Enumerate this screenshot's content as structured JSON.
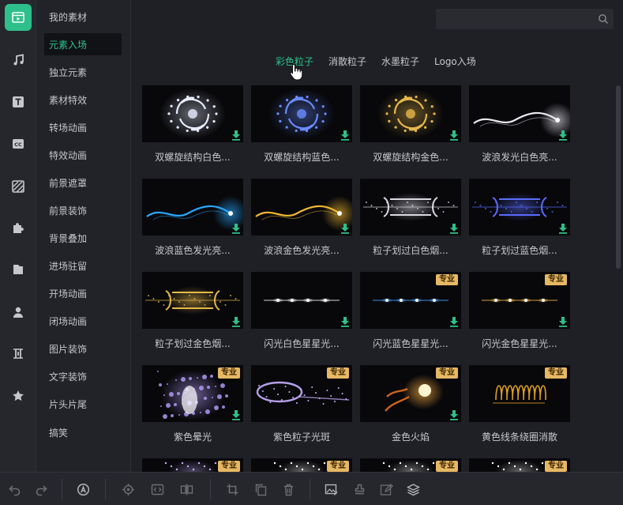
{
  "rail": {
    "items": [
      {
        "icon": "video-clip-icon",
        "active": true
      },
      {
        "icon": "music-note-icon"
      },
      {
        "icon": "text-icon"
      },
      {
        "icon": "subtitle-cc-icon"
      },
      {
        "icon": "filter-stripes-icon"
      },
      {
        "icon": "puzzle-icon"
      },
      {
        "icon": "folder-icon"
      },
      {
        "icon": "person-icon"
      },
      {
        "icon": "pitch-slider-icon"
      },
      {
        "icon": "star-icon"
      }
    ]
  },
  "categories": {
    "items": [
      {
        "label": "我的素材"
      },
      {
        "label": "元素入场",
        "active": true
      },
      {
        "label": "独立元素"
      },
      {
        "label": "素材特效"
      },
      {
        "label": "转场动画"
      },
      {
        "label": "特效动画"
      },
      {
        "label": "前景遮罩"
      },
      {
        "label": "前景装饰"
      },
      {
        "label": "背景叠加"
      },
      {
        "label": "进场驻留"
      },
      {
        "label": "开场动画"
      },
      {
        "label": "闭场动画"
      },
      {
        "label": "图片装饰"
      },
      {
        "label": "文字装饰"
      },
      {
        "label": "片头片尾"
      },
      {
        "label": "搞笑"
      }
    ]
  },
  "search": {
    "placeholder": "",
    "icon": "search-icon"
  },
  "tabs": {
    "items": [
      {
        "label": "彩色粒子",
        "active": true
      },
      {
        "label": "消散粒子"
      },
      {
        "label": "水墨粒子"
      },
      {
        "label": "Logo入场"
      }
    ]
  },
  "grid": {
    "pro_label": "专业",
    "items": [
      {
        "title": "双螺旋结构白色...",
        "art": "swirl",
        "color": "#e8ecff",
        "download": true,
        "pro": false
      },
      {
        "title": "双螺旋结构蓝色...",
        "art": "swirl",
        "color": "#6a8cff",
        "download": true,
        "pro": false
      },
      {
        "title": "双螺旋结构金色...",
        "art": "swirl",
        "color": "#e6b84a",
        "download": true,
        "pro": false
      },
      {
        "title": "波浪发光白色亮...",
        "art": "wave",
        "color": "#e8e8ee",
        "download": true,
        "pro": false
      },
      {
        "title": "波浪蓝色发光亮...",
        "art": "wave",
        "color": "#2aa8ff",
        "download": true,
        "pro": false
      },
      {
        "title": "波浪金色发光亮...",
        "art": "wave",
        "color": "#f0b830",
        "download": true,
        "pro": false
      },
      {
        "title": "粒子划过白色烟...",
        "art": "smoke",
        "color": "#d8d8e0",
        "download": true,
        "pro": false
      },
      {
        "title": "粒子划过蓝色烟...",
        "art": "smoke",
        "color": "#5a6cff",
        "download": true,
        "pro": false
      },
      {
        "title": "粒子划过金色烟...",
        "art": "smoke",
        "color": "#e6b84a",
        "download": true,
        "pro": false
      },
      {
        "title": "闪光白色星星光...",
        "art": "sparkle",
        "color": "#f0f0f6",
        "download": true,
        "pro": false
      },
      {
        "title": "闪光蓝色星星光...",
        "art": "sparkle",
        "color": "#4aa0ff",
        "download": true,
        "pro": true
      },
      {
        "title": "闪光金色星星光...",
        "art": "sparkle",
        "color": "#f0b040",
        "download": true,
        "pro": true
      },
      {
        "title": "紫色晕光",
        "art": "glow",
        "color": "#b8a0ff",
        "download": true,
        "pro": true
      },
      {
        "title": "紫色粒子光斑",
        "art": "comet",
        "color": "#c8b0ff",
        "download": false,
        "pro": true
      },
      {
        "title": "金色火焰",
        "art": "fire",
        "color": "#ffb040",
        "download": true,
        "pro": true
      },
      {
        "title": "黄色线条绕圈消散",
        "art": "coil",
        "color": "#e0a020",
        "download": false,
        "pro": true
      },
      {
        "title": "",
        "art": "partial",
        "color": "#c8b0ff",
        "download": false,
        "pro": true
      },
      {
        "title": "",
        "art": "partial",
        "color": "#ffffff",
        "download": false,
        "pro": true
      },
      {
        "title": "",
        "art": "partial",
        "color": "#ffffff",
        "download": false,
        "pro": true
      },
      {
        "title": "",
        "art": "partial",
        "color": "#ffffff",
        "download": false,
        "pro": true
      }
    ]
  },
  "toolbar": {
    "items": [
      {
        "icon": "undo-icon"
      },
      {
        "icon": "redo-icon"
      },
      {
        "icon": "auto-a-icon"
      },
      {
        "icon": "target-icon"
      },
      {
        "icon": "code-brackets-icon"
      },
      {
        "icon": "split-icon"
      },
      {
        "icon": "crop-icon"
      },
      {
        "icon": "copy-icon"
      },
      {
        "icon": "delete-icon"
      },
      {
        "icon": "image-edit-icon"
      },
      {
        "icon": "stamp-icon"
      },
      {
        "icon": "pencil-icon"
      },
      {
        "icon": "layers-icon"
      }
    ]
  },
  "colors": {
    "accent": "#2ec08a",
    "download": "#2ec08a",
    "pro_badge": "#e7b864"
  }
}
